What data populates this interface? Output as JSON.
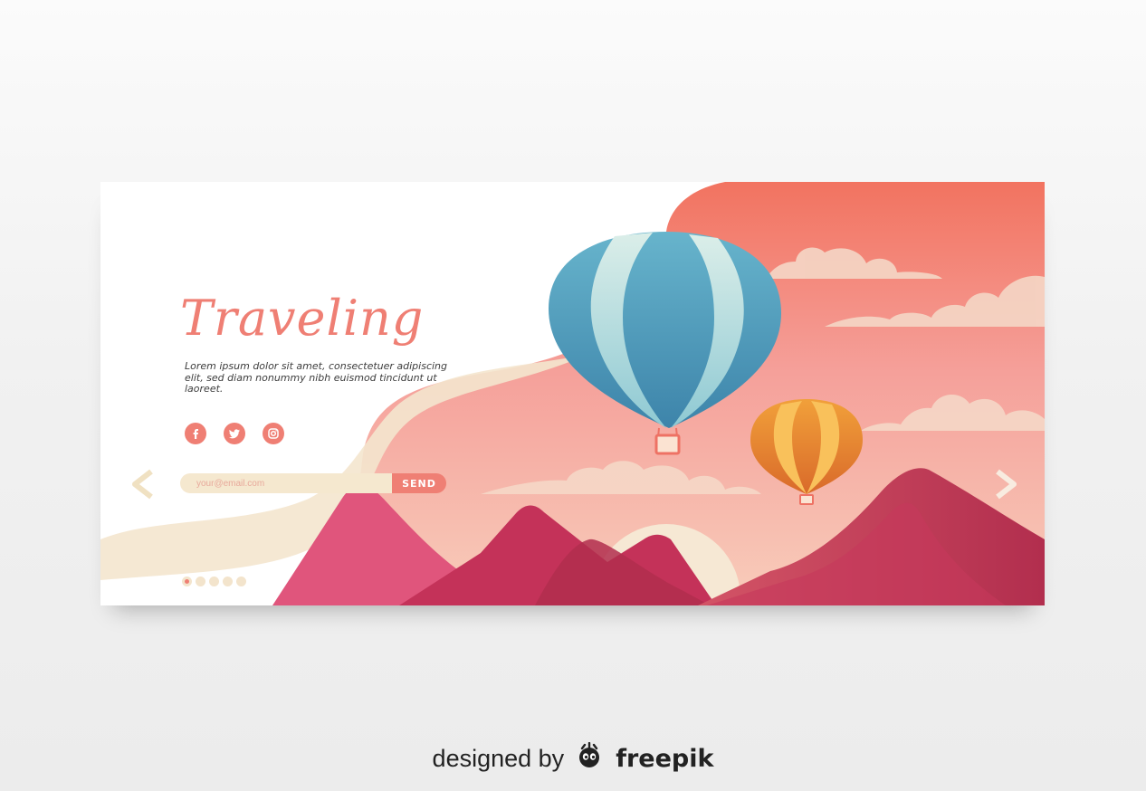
{
  "hero": {
    "title": "Traveling",
    "description": "Lorem ipsum dolor sit amet, consectetuer adipiscing elit, sed diam nonummy nibh euismod tincidunt ut laoreet."
  },
  "social": [
    {
      "name": "facebook-icon",
      "glyph": "f"
    },
    {
      "name": "twitter-icon",
      "glyph": ""
    },
    {
      "name": "instagram-icon",
      "glyph": ""
    }
  ],
  "subscribe": {
    "placeholder": "your@email.com",
    "button_label": "SEND"
  },
  "pagination": {
    "total": 5,
    "active": 1
  },
  "colors": {
    "accent": "#ef7f74",
    "cream": "#f5e8cf",
    "sky_top": "#f27360",
    "balloon_blue": "#5aa5c3",
    "balloon_orange": "#f0952f",
    "mountain": "#c7395c"
  },
  "credit": {
    "prefix": "designed by",
    "brand": "freepik"
  }
}
